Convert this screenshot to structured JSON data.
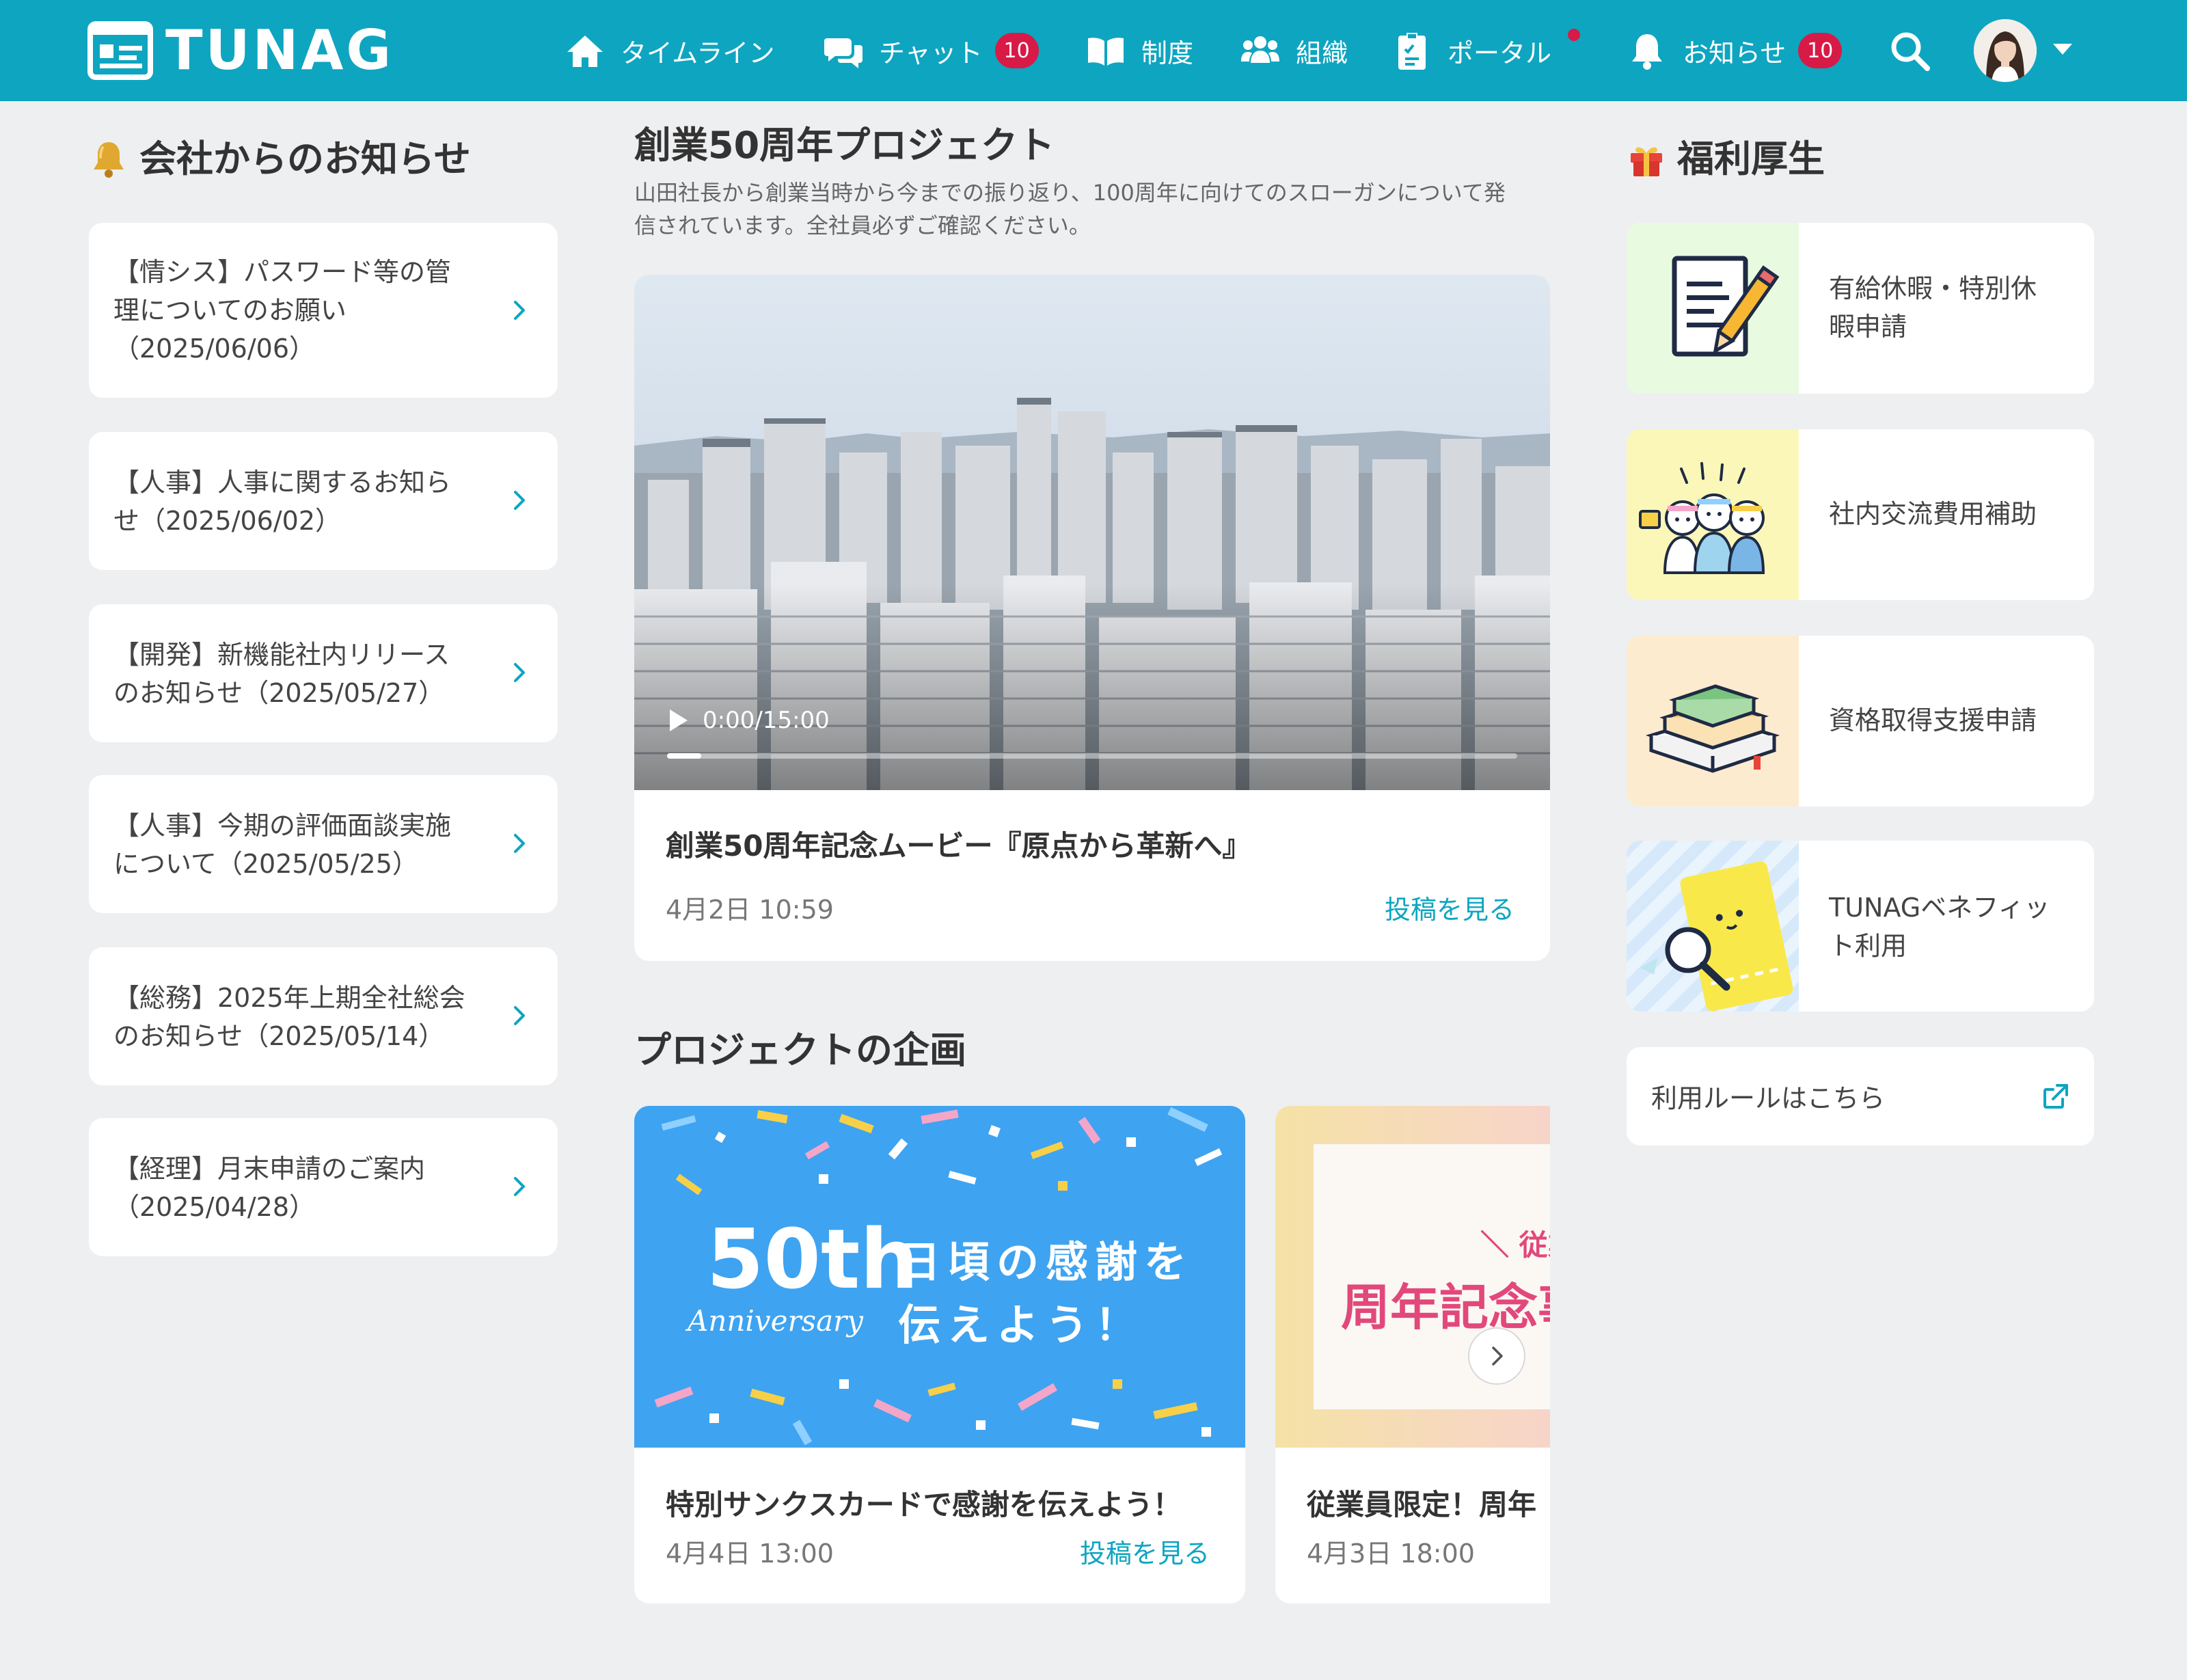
{
  "app": {
    "logo_text": "TUNAG"
  },
  "nav": {
    "timeline": "タイムライン",
    "chat": "チャット",
    "chat_badge": "10",
    "system": "制度",
    "org": "組織",
    "portal": "ポータル",
    "notify": "お知らせ",
    "notify_badge": "10"
  },
  "colors": {
    "brand": "#0ea5c0",
    "badge": "#d81a46"
  },
  "left": {
    "title": "会社からのお知らせ",
    "items": [
      {
        "lines": [
          "【情シス】パスワード等の管",
          "理についてのお願い",
          "（2025/06/06）"
        ]
      },
      {
        "lines": [
          "【人事】人事に関するお知ら",
          "せ（2025/06/02）"
        ]
      },
      {
        "lines": [
          "【開発】新機能社内リリース",
          "のお知らせ（2025/05/27）"
        ]
      },
      {
        "lines": [
          "【人事】今期の評価面談実施",
          "について（2025/05/25）"
        ]
      },
      {
        "lines": [
          "【総務】2025年上期全社総会",
          "のお知らせ（2025/05/14）"
        ]
      },
      {
        "lines": [
          "【経理】月末申請のご案内",
          "（2025/04/28）"
        ]
      }
    ]
  },
  "center": {
    "project_title": "創業50周年プロジェクト",
    "project_desc": [
      "山田社長から創業当時から今までの振り返り、100周年に向けてのスローガンについて発",
      "信されています。全社員必ずご確認ください。"
    ],
    "video": {
      "time": "0:00/15:00",
      "progress": 0.04,
      "title": "創業50周年記念ムービー『原点から革新へ』",
      "date": "4月2日 10:59",
      "link": "投稿を見る"
    },
    "plans_title": "プロジェクトの企画",
    "plans": [
      {
        "banner_big": "50th",
        "banner_script": "Anniversary",
        "banner_line1": "日頃の感謝を",
        "banner_line2": "伝えよう！",
        "title": "特別サンクスカードで感謝を伝えよう！",
        "date": "4月4日 13:00",
        "link": "投稿を見る"
      },
      {
        "banner_small": "＼ 従業",
        "banner_main": "周年記念事",
        "title": "従業員限定！周年",
        "date": "4月3日 18:00"
      }
    ]
  },
  "right": {
    "title": "福利厚生",
    "items": [
      {
        "lines": [
          "有給休暇・特別休",
          "暇申請"
        ],
        "icon": "document-pencil-icon"
      },
      {
        "lines": [
          "社内交流費用補助"
        ],
        "icon": "cheering-people-icon"
      },
      {
        "lines": [
          "資格取得支援申請"
        ],
        "icon": "books-icon"
      },
      {
        "lines": [
          "TUNAGベネフィッ",
          "ト利用"
        ],
        "icon": "ticket-search-icon"
      }
    ],
    "rules": "利用ルールはこちら"
  }
}
